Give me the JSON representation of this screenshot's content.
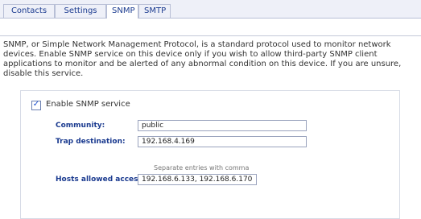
{
  "tabs": [
    {
      "label": "Contacts",
      "active": false
    },
    {
      "label": "Settings",
      "active": false
    },
    {
      "label": "SNMP",
      "active": true
    },
    {
      "label": "SMTP",
      "active": false
    }
  ],
  "description": "SNMP, or Simple Network Management Protocol, is a standard protocol used to monitor network devices. Enable SNMP service on this device only if you wish to allow third-party SNMP client applications to monitor and be alerted of any abnormal condition on this device. If you are unsure, disable this service.",
  "snmp": {
    "enable_label": "Enable SNMP service",
    "enabled": true,
    "community_label": "Community:",
    "community_value": "public",
    "trap_label": "Trap destination:",
    "trap_value": "192.168.4.169",
    "hint": "Separate entries with comma",
    "hosts_label": "Hosts allowed access:",
    "hosts_value": "192.168.6.133, 192.168.6.170"
  }
}
